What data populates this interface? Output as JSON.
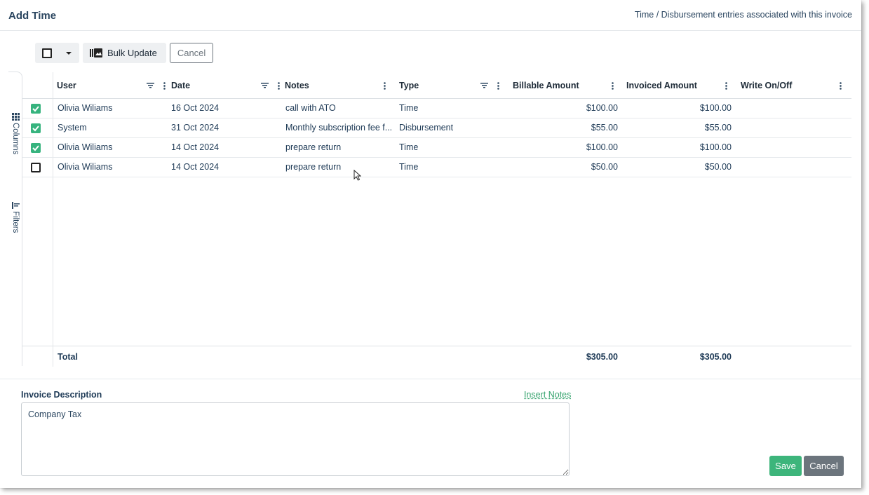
{
  "header": {
    "title": "Add Time",
    "subtitle": "Time / Disbursement entries associated with this invoice"
  },
  "toolbar": {
    "bulk_update_label": "Bulk Update",
    "cancel_label": "Cancel"
  },
  "sidebar": {
    "columns_label": "Columns",
    "filters_label": "Filters"
  },
  "table": {
    "columns": [
      "User",
      "Date",
      "Notes",
      "Type",
      "Billable Amount",
      "Invoiced Amount",
      "Write On/Off"
    ],
    "rows": [
      {
        "checked": true,
        "user": "Olivia Wiliams",
        "date": "16 Oct 2024",
        "notes": "call with ATO",
        "type": "Time",
        "billable": "$100.00",
        "invoiced": "$100.00",
        "write": ""
      },
      {
        "checked": true,
        "user": "System",
        "date": "31 Oct 2024",
        "notes": "Monthly subscription fee f...",
        "type": "Disbursement",
        "billable": "$55.00",
        "invoiced": "$55.00",
        "write": ""
      },
      {
        "checked": true,
        "user": "Olivia Wiliams",
        "date": "14 Oct 2024",
        "notes": "prepare return",
        "type": "Time",
        "billable": "$100.00",
        "invoiced": "$100.00",
        "write": ""
      },
      {
        "checked": false,
        "user": "Olivia Wiliams",
        "date": "14 Oct 2024",
        "notes": "prepare return",
        "type": "Time",
        "billable": "$50.00",
        "invoiced": "$50.00",
        "write": ""
      }
    ],
    "total": {
      "label": "Total",
      "billable": "$305.00",
      "invoiced": "$305.00"
    }
  },
  "invoice": {
    "description_label": "Invoice Description",
    "insert_notes_label": "Insert Notes",
    "description_value": "Company Tax"
  },
  "actions": {
    "save_label": "Save",
    "cancel_label": "Cancel"
  },
  "colors": {
    "accent_green": "#3db57b",
    "secondary_gray": "#6c757d",
    "text_navy": "#1e3a56"
  }
}
